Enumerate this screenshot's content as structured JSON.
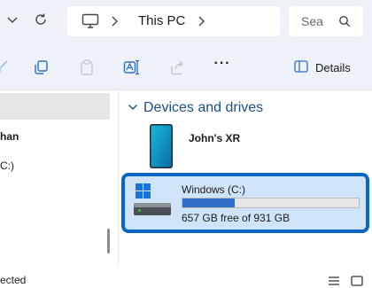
{
  "address": {
    "breadcrumb": "This PC"
  },
  "search": {
    "placeholder": "Sea"
  },
  "command_bar": {
    "more_label": "···",
    "details_label": "Details"
  },
  "nav_pane": {
    "items": [
      {
        "label": ""
      },
      {
        "label": "han"
      },
      {
        "label": "C:)"
      }
    ]
  },
  "content": {
    "section_title": "Devices and drives",
    "device": {
      "name": "John's XR"
    },
    "drive": {
      "name": "Windows (C:)",
      "used_fraction": 0.294,
      "free_text": "657 GB free of 931 GB"
    }
  },
  "status_bar": {
    "text": "ected"
  },
  "colors": {
    "accent": "#0a66c2",
    "selection_fill": "#cfe3f9",
    "section_title": "#1c4f8a",
    "chrome_background": "#eef2f8"
  }
}
